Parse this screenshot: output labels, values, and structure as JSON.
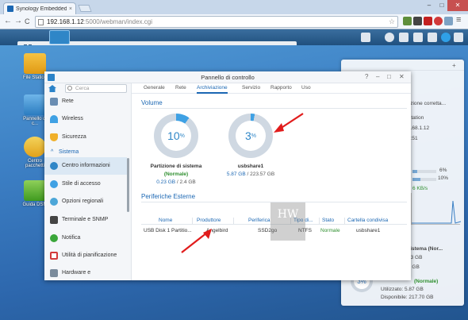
{
  "browser": {
    "tab_title": "Synology Embedded Data",
    "tab_close": "×",
    "url_host": "192.168.1.12",
    "url_rest": ":5000/webman/index.cgi",
    "win_min": "–",
    "win_max": "□",
    "win_close": "✕",
    "back": "←",
    "forward": "→",
    "reload": "C",
    "star": "☆",
    "menu": "≡"
  },
  "desktop": {
    "icons": [
      {
        "label": "File Station"
      },
      {
        "label": "Pannello di c..."
      },
      {
        "label": "Centro pacchetti"
      },
      {
        "label": "Guida DSM"
      }
    ]
  },
  "widget": {
    "lines": [
      {
        "text": "unzione corretta..."
      },
      {
        "text": "Station"
      },
      {
        "text": ".168.1.12"
      },
      {
        "text": "1:51"
      },
      {
        "text": "6%"
      },
      {
        "text": "10%"
      },
      {
        "text": "6 KB/s"
      },
      {
        "text": "l sistema (Nor..."
      },
      {
        "text": "23 GB"
      },
      {
        "text": "2 GB"
      },
      {
        "text": "(Normale)"
      },
      {
        "text": "Utilizzato: 5.87 GB"
      },
      {
        "text": "Disponibile: 217.70 GB"
      }
    ],
    "donut_label": "3%",
    "colors": {
      "accent": "#3fa1e4"
    }
  },
  "window": {
    "title": "Pannello di controllo",
    "help": "?",
    "minimize": "–",
    "maximize": "□",
    "close": "✕",
    "search_placeholder": "Cerca",
    "sidebar": {
      "items_top": [
        {
          "label": "Rete",
          "icon": "network-icon"
        },
        {
          "label": "Wireless",
          "icon": "wifi-icon"
        },
        {
          "label": "Sicurezza",
          "icon": "shield-icon"
        }
      ],
      "section": "Sistema",
      "items_sys": [
        {
          "label": "Centro informazioni",
          "icon": "info-icon",
          "active": true
        },
        {
          "label": "Stile di accesso",
          "icon": "palette-icon"
        },
        {
          "label": "Opzioni regionali",
          "icon": "globe-icon"
        },
        {
          "label": "Terminale e SNMP",
          "icon": "terminal-icon"
        },
        {
          "label": "Notifica",
          "icon": "chat-icon"
        },
        {
          "label": "Utilità di pianificazione",
          "icon": "calendar-icon"
        },
        {
          "label": "Hardware e",
          "icon": "hardware-icon"
        }
      ]
    },
    "tabs": [
      "Generale",
      "Rete",
      "Archiviazione",
      "Servizio",
      "Rapporto",
      "Uso"
    ],
    "active_tab": "Archiviazione",
    "volume_section": "Volume",
    "volumes": [
      {
        "percent": 10,
        "percent_num": "10",
        "percent_sym": "%",
        "name": "Partizione di sistema",
        "status": "(Normale)",
        "used": "0.23 GB",
        "total": "2.4 GB"
      },
      {
        "percent": 3,
        "percent_num": "3",
        "percent_sym": "%",
        "name": "usbshare1",
        "status": "(Normale)",
        "used": "5.87 GB",
        "total": "223.57 GB"
      }
    ],
    "usage_sep": " / ",
    "devices_section": "Periferiche Esterne",
    "table": {
      "headers": [
        "Nome",
        "Produttore",
        "Periferica",
        "Tipo di...",
        "Stato",
        "Cartella condivisa"
      ],
      "rows": [
        [
          "USB Disk 1 Partitio...",
          "Angelbird",
          "SSD2go",
          "NTFS",
          "Normale",
          "usbshare1"
        ]
      ]
    },
    "watermark": "HW"
  },
  "colors": {
    "brand": "#1b67b3",
    "donut_fill": "#3fa1e4",
    "donut_track": "#cfd8e2",
    "arrow": "#e11c1c",
    "ok": "#2f8f2f"
  }
}
